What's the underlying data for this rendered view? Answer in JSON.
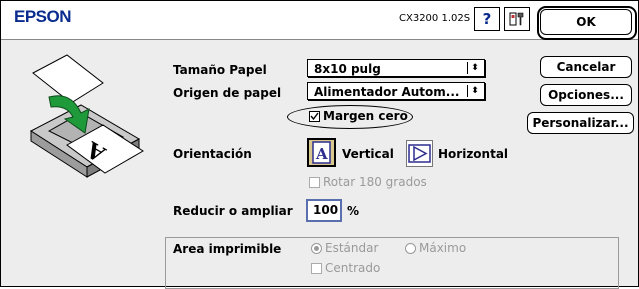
{
  "header": {
    "brand": "EPSON",
    "model": "CX3200 1.02S",
    "help_glyph": "?"
  },
  "buttons": {
    "ok": "OK",
    "cancel": "Cancelar",
    "options": "Opciones...",
    "customize": "Personalizar..."
  },
  "paper": {
    "size_label": "Tamaño Papel",
    "size_value": "8x10 pulg",
    "source_label": "Origen de papel",
    "source_value": "Alimentador Autom...",
    "zero_margin_label": "Margen cero",
    "zero_margin_checked": true
  },
  "orientation": {
    "label": "Orientación",
    "vertical": "Vertical",
    "horizontal": "Horizontal",
    "selected": "vertical",
    "rotate_label": "Rotar 180 grados",
    "rotate_checked": false
  },
  "scale": {
    "label": "Reducir o ampliar",
    "value": "100",
    "unit": "%"
  },
  "printable_area": {
    "label": "Area imprimible",
    "standard": "Estándar",
    "maximum": "Máximo",
    "selected": "standard",
    "centered": "Centrado"
  },
  "icons": [
    "printer-illustration-icon",
    "help-icon",
    "tools-icon",
    "portrait-orientation-icon",
    "landscape-orientation-icon"
  ],
  "colors": {
    "brand": "#0a2c8f",
    "dialog_bg": "#ededed",
    "disabled": "#9a9a9a",
    "arrow_green": "#1f9a3a"
  }
}
